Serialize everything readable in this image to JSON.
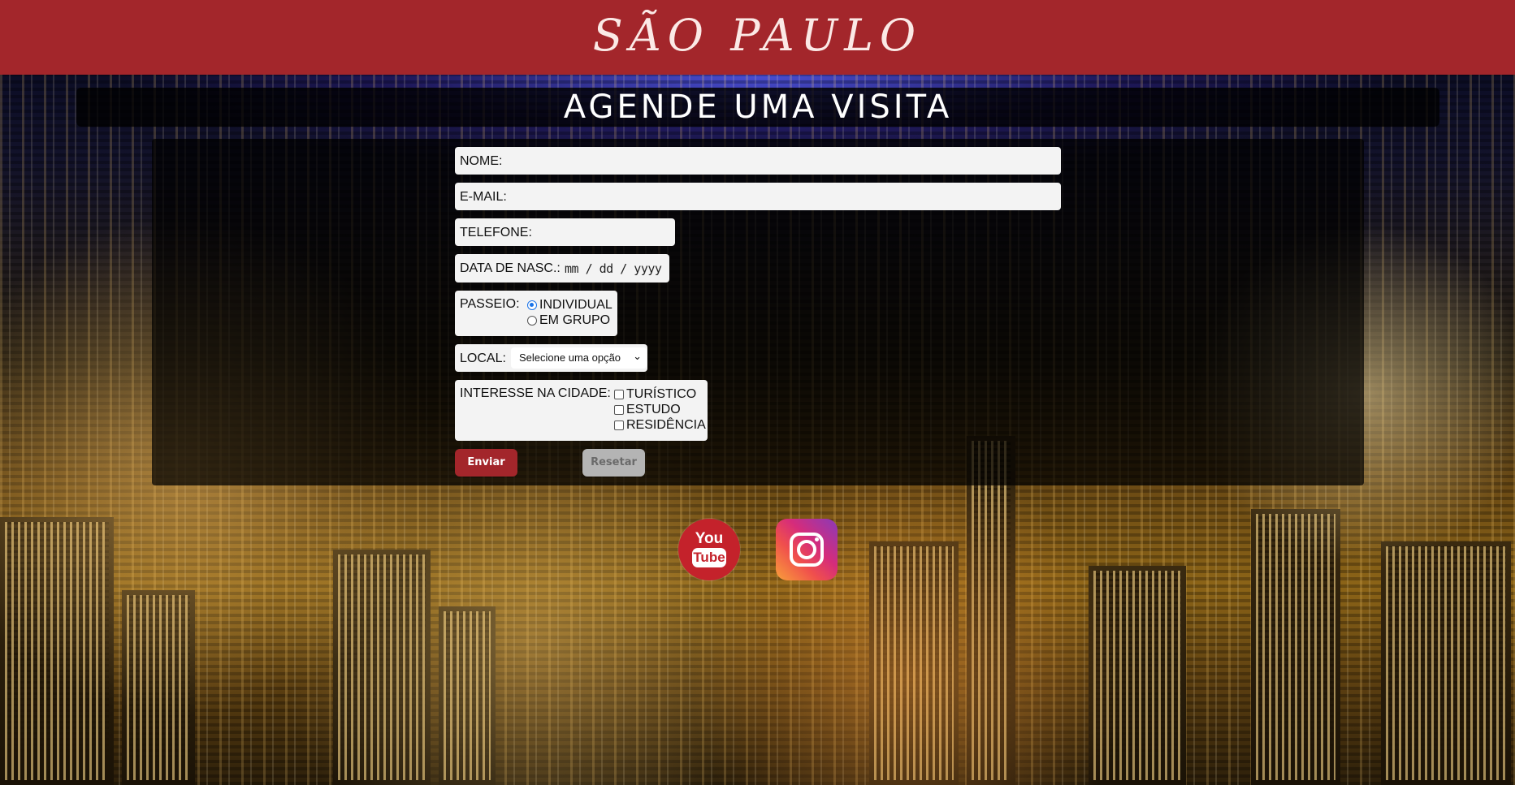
{
  "header": {
    "brand": "SÃO PAULO"
  },
  "title": "AGENDE UMA VISITA",
  "form": {
    "name_label": "NOME:",
    "email_label": "E-MAIL:",
    "phone_label": "TELEFONE:",
    "birth_label": "DATA DE NASC.:",
    "birth_placeholder": "mm / dd / yyyy",
    "tour_label": "PASSEIO:",
    "tour_options": [
      {
        "label": "INDIVIDUAL",
        "selected": true
      },
      {
        "label": "EM GRUPO",
        "selected": false
      }
    ],
    "local_label": "LOCAL:",
    "local_selected": "Selecione uma opção",
    "interest_label": "INTERESSE NA CIDADE:",
    "interest_options": [
      {
        "label": "TURÍSTICO",
        "checked": false
      },
      {
        "label": "ESTUDO",
        "checked": false
      },
      {
        "label": "RESIDÊNCIA",
        "checked": false
      }
    ],
    "submit_label": "Enviar",
    "reset_label": "Resetar"
  },
  "social": {
    "youtube_top": "You",
    "youtube_bottom": "Tube"
  },
  "colors": {
    "brand_red": "#a3262b",
    "youtube_red": "#c4222b",
    "radio_blue": "#1a73e8"
  }
}
